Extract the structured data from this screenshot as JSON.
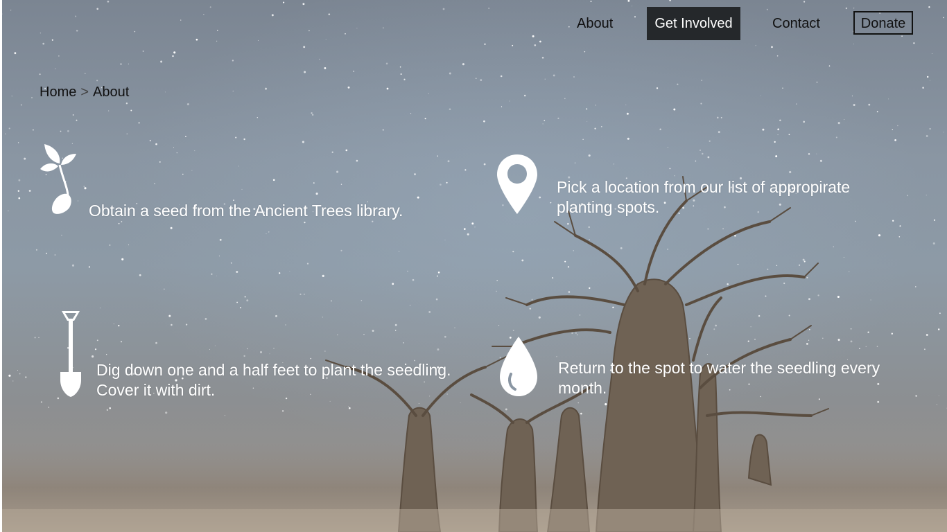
{
  "nav": {
    "about": "About",
    "get_involved": "Get Involved",
    "contact": "Contact",
    "donate": "Donate",
    "active": "Get Involved"
  },
  "breadcrumb": {
    "home": "Home",
    "separator": ">",
    "current": "About"
  },
  "steps": [
    {
      "icon": "seedling-icon",
      "text": "Obtain a seed from the Ancient Trees library."
    },
    {
      "icon": "map-pin-icon",
      "text": "Pick a location from our list of appropirate planting spots."
    },
    {
      "icon": "shovel-icon",
      "text": "Dig down one and a half feet to plant the seedling. Cover it with dirt."
    },
    {
      "icon": "water-drop-icon",
      "text": "Return to the spot to water the seedling every month."
    }
  ],
  "colors": {
    "active_nav_bg": "#25282b",
    "step_text": "#ffffff",
    "nav_text": "#111111"
  }
}
